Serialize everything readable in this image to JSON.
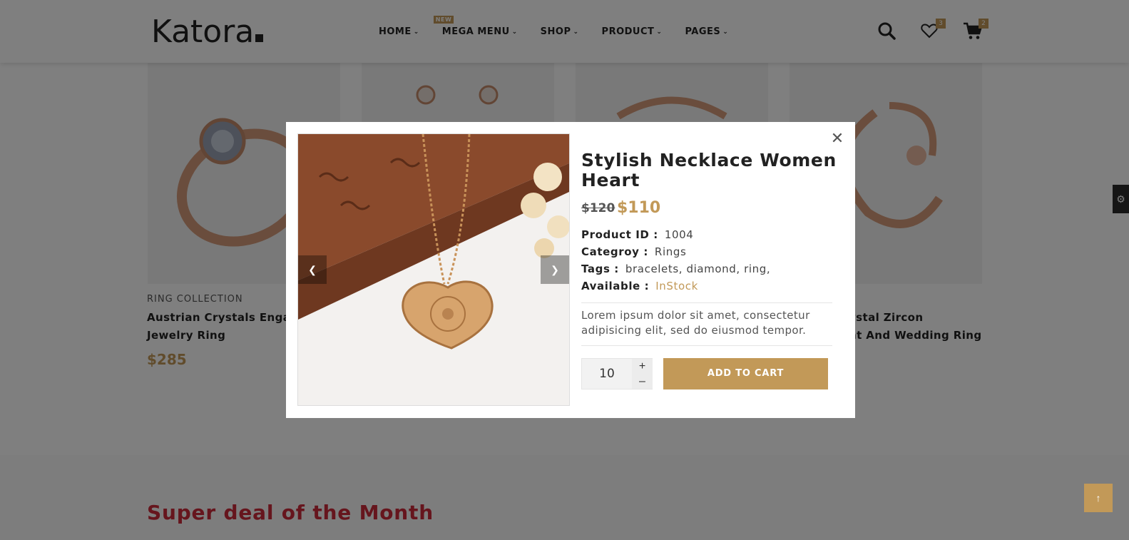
{
  "header": {
    "logo": "Katora",
    "nav": [
      {
        "label": "HOME"
      },
      {
        "label": "MEGA MENU",
        "badge": "NEW"
      },
      {
        "label": "SHOP"
      },
      {
        "label": "PRODUCT"
      },
      {
        "label": "PAGES"
      }
    ],
    "wishlist_count": "3",
    "cart_count": "2"
  },
  "products": [
    {
      "category": "RING COLLECTION",
      "title_line1": "Austrian Crystals Engag",
      "title_line2": "Jewelry Ring",
      "price": "$285"
    },
    {
      "title_line1": "ystal Zircon",
      "title_line2": "nt And Wedding Ring"
    }
  ],
  "deal": {
    "title": "Super deal of the Month"
  },
  "modal": {
    "title": "Stylish Necklace Women Heart",
    "old_price": "$120",
    "new_price": "$110",
    "details": [
      {
        "label": "Product ID :",
        "value": "1004"
      },
      {
        "label": "Categroy :",
        "value": "Rings"
      },
      {
        "label": "Tags :",
        "value": "bracelets, diamond, ring,"
      },
      {
        "label": "Available :",
        "value": "InStock"
      }
    ],
    "description": "Lorem ipsum dolor sit amet, consectetur adipisicing elit, sed do eiusmod tempor.",
    "quantity": "10",
    "add_to_cart": "ADD TO CART"
  },
  "colors": {
    "accent": "#c29958",
    "deal_title": "#cc2a3a",
    "overlay": "rgba(0,0,0,0.5)"
  },
  "icons": [
    "search-icon",
    "heart-icon",
    "cart-icon",
    "close-icon",
    "chevron-left-icon",
    "chevron-right-icon",
    "gear-icon",
    "arrow-up-icon"
  ]
}
